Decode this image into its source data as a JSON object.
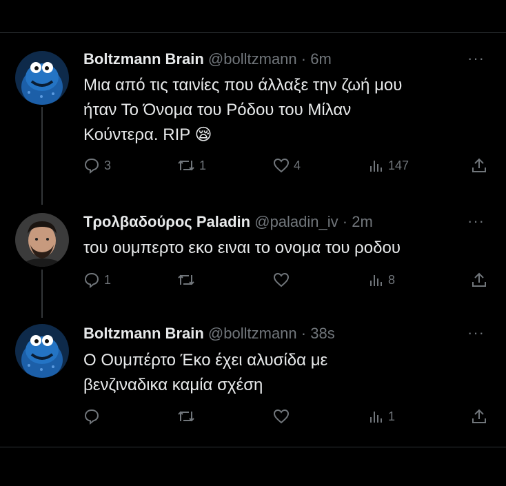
{
  "tweets": [
    {
      "name": "Boltzmann Brain",
      "handle": "@bolltzmann",
      "time": "6m",
      "text_lines": [
        "Μια από τις ταινίες που άλλαξε την ζωή μου",
        "ήταν Το Όνομα του Ρόδου του Μίλαν",
        "Κούντερα. RIP"
      ],
      "emoji": "😪",
      "replies": "3",
      "retweets": "1",
      "likes": "4",
      "views": "147"
    },
    {
      "name": "Τρολβαδούρος Paladin",
      "handle": "@paladin_iv",
      "time": "2m",
      "text_lines": [
        "του ουμπερτο εκο ειναι το ονομα του ροδου"
      ],
      "replies": "1",
      "retweets": "",
      "likes": "",
      "views": "8"
    },
    {
      "name": "Boltzmann Brain",
      "handle": "@bolltzmann",
      "time": "38s",
      "text_lines": [
        "Ο Ουμπέρτο Έκο έχει αλυσίδα με",
        "βενζιναδικα καμία σχέση"
      ],
      "replies": "",
      "retweets": "",
      "likes": "",
      "views": "1"
    }
  ],
  "separator": " · ",
  "more_label": "···",
  "colors": {
    "background": "#000000",
    "text": "#e7e9ea",
    "muted": "#71767b",
    "divider": "#2f3336"
  },
  "icons": {
    "reply": "reply-icon",
    "retweet": "retweet-icon",
    "like": "heart-icon",
    "views": "views-icon",
    "share": "share-icon",
    "more": "more-icon"
  }
}
